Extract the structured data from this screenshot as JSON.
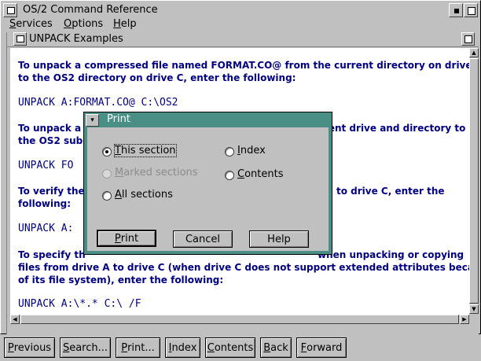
{
  "window": {
    "title": "OS/2 Command Reference"
  },
  "menu": {
    "items": [
      {
        "label": "Services",
        "mnemonic": "S",
        "rest": "ervices"
      },
      {
        "label": "Options",
        "mnemonic": "O",
        "rest": "ptions"
      },
      {
        "label": "Help",
        "mnemonic": "H",
        "rest": "elp"
      }
    ]
  },
  "child_window": {
    "title": "UNPACK Examples"
  },
  "content": {
    "p1_line1": "To unpack a compressed file named FORMAT.CO@ from the current directory on drive A",
    "p1_line2": "to the OS2 directory on drive C, enter the following:",
    "code1": "UNPACK A:FORMAT.CO@ C:\\OS2",
    "p2_line1a": "To unpack a",
    "p2_line1b": "rrent drive and directory to",
    "p2_line2a": "the OS2 subc",
    "code2a": "UNPACK FO",
    "p3_line1a": "To verify the",
    "p3_line1b": "to drive C, enter the",
    "p3_line2": "following:",
    "code3a": "UNPACK A:",
    "p4_line1a": "To specify th",
    "p4_line1b": "when unpacking or copying",
    "p4_line2": "files from drive A to drive C (when drive C does not support extended attributes because",
    "p4_line3": "of its file system), enter the following:",
    "code4": "UNPACK A:\\*.* C:\\ /F"
  },
  "buttonbar": {
    "previous": {
      "label": "Previous",
      "mnemonic": "P",
      "rest": "revious"
    },
    "search": {
      "label": "Search...",
      "mnemonic": "S",
      "rest": "earch..."
    },
    "print": {
      "label": "Print...",
      "mnemonic": "P",
      "rest": "rint..."
    },
    "index": {
      "label": "Index",
      "mnemonic": "I",
      "rest": "ndex"
    },
    "contents": {
      "label": "Contents",
      "mnemonic": "C",
      "rest": "ontents"
    },
    "back": {
      "label": "Back",
      "mnemonic": "B",
      "rest": "ack"
    },
    "forward": {
      "label": "Forward",
      "mnemonic": "F",
      "rest": "orward"
    }
  },
  "print_dialog": {
    "title": "Print",
    "options": {
      "this_section": {
        "mnemonic": "T",
        "rest": "his section",
        "selected": true,
        "enabled": true
      },
      "marked_sections": {
        "mnemonic": "M",
        "rest": "arked sections",
        "selected": false,
        "enabled": false
      },
      "all_sections": {
        "mnemonic": "A",
        "rest": "ll sections",
        "selected": false,
        "enabled": true
      },
      "index": {
        "mnemonic": "I",
        "rest": "ndex",
        "selected": false,
        "enabled": true
      },
      "contents": {
        "mnemonic": "C",
        "rest": "ontents",
        "selected": false,
        "enabled": true
      }
    },
    "buttons": {
      "print": {
        "mnemonic": "P",
        "rest": "rint"
      },
      "cancel": "Cancel",
      "help": "Help"
    }
  }
}
